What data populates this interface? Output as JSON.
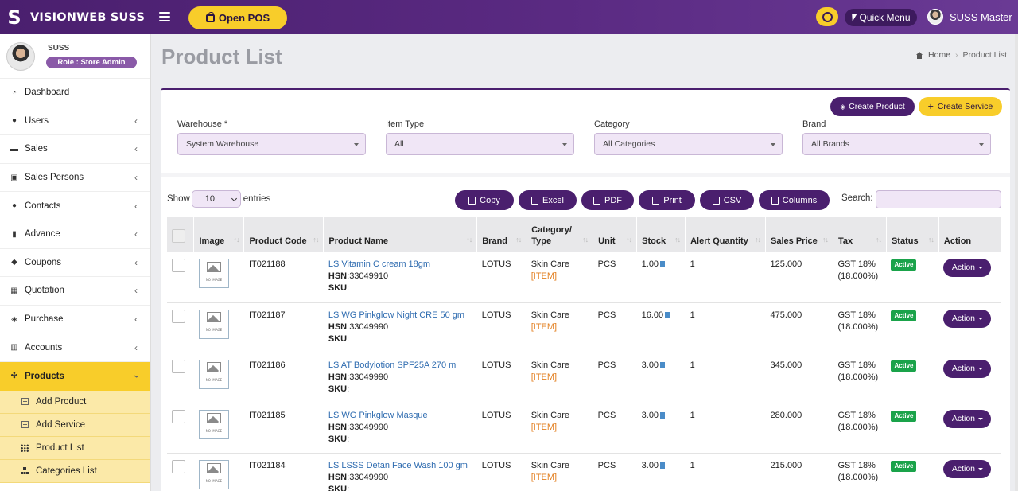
{
  "app": {
    "name": "VISIONWEB SUSS",
    "logo_letter": "S"
  },
  "topbar": {
    "open_pos": "Open POS",
    "quick_menu": "Quick Menu",
    "user": "SUSS Master"
  },
  "profile": {
    "name": "SUSS",
    "role": "Role : Store Admin"
  },
  "nav": [
    {
      "label": "Dashboard",
      "icon": "dashboard-icon",
      "glyph": "◔",
      "chevron": false
    },
    {
      "label": "Users",
      "icon": "user-icon",
      "glyph": "●",
      "chevron": true
    },
    {
      "label": "Sales",
      "icon": "cart-icon",
      "glyph": "▬",
      "chevron": true
    },
    {
      "label": "Sales Persons",
      "icon": "id-card-icon",
      "glyph": "▣",
      "chevron": true
    },
    {
      "label": "Contacts",
      "icon": "users-icon",
      "glyph": "●",
      "chevron": true
    },
    {
      "label": "Advance",
      "icon": "book-icon",
      "glyph": "▮",
      "chevron": true
    },
    {
      "label": "Coupons",
      "icon": "tag-icon",
      "glyph": "◆",
      "chevron": true
    },
    {
      "label": "Quotation",
      "icon": "calendar-icon",
      "glyph": "▦",
      "chevron": true
    },
    {
      "label": "Purchase",
      "icon": "cube-icon",
      "glyph": "◈",
      "chevron": true
    },
    {
      "label": "Accounts",
      "icon": "bank-icon",
      "glyph": "▥",
      "chevron": true
    },
    {
      "label": "Products",
      "icon": "cubes-icon",
      "glyph": "✣",
      "chevron": true,
      "active": true
    }
  ],
  "subnav": [
    {
      "label": "Add Product",
      "icon": "plus-square-icon"
    },
    {
      "label": "Add Service",
      "icon": "plus-square-icon"
    },
    {
      "label": "Product List",
      "icon": "grid-icon"
    },
    {
      "label": "Categories List",
      "icon": "sitemap-icon"
    }
  ],
  "page": {
    "title": "Product List",
    "breadcrumb": [
      "Home",
      "Product List"
    ]
  },
  "actions": {
    "create_product": "Create Product",
    "create_service": "Create Service"
  },
  "filters": [
    {
      "label": "Warehouse *",
      "value": "System Warehouse"
    },
    {
      "label": "Item Type",
      "value": "All"
    },
    {
      "label": "Category",
      "value": "All Categories"
    },
    {
      "label": "Brand",
      "value": "All Brands"
    }
  ],
  "table_tools": {
    "show": "Show",
    "entries_value": "10",
    "entries": "entries",
    "buttons": [
      "Copy",
      "Excel",
      "PDF",
      "Print",
      "CSV",
      "Columns"
    ],
    "search_label": "Search:"
  },
  "columns": [
    "",
    "Image",
    "Product Code",
    "Product Name",
    "Brand",
    "Category/ Type",
    "Unit",
    "Stock",
    "Alert Quantity",
    "Sales Price",
    "Tax",
    "Status",
    "Action"
  ],
  "rows": [
    {
      "code": "IT021188",
      "name": "LS Vitamin C cream 18gm",
      "hsn": "33049910",
      "brand": "LOTUS",
      "category": "Skin Care",
      "type": "ITEM",
      "unit": "PCS",
      "stock": "1.00",
      "alert": "1",
      "price": "125.000",
      "tax": "GST 18%",
      "tax_pct": "(18.000%)",
      "status": "Active",
      "action": "Action"
    },
    {
      "code": "IT021187",
      "name": "LS WG Pinkglow Night CRE 50 gm",
      "hsn": "33049990",
      "brand": "LOTUS",
      "category": "Skin Care",
      "type": "ITEM",
      "unit": "PCS",
      "stock": "16.00",
      "alert": "1",
      "price": "475.000",
      "tax": "GST 18%",
      "tax_pct": "(18.000%)",
      "status": "Active",
      "action": "Action"
    },
    {
      "code": "IT021186",
      "name": "LS AT Bodylotion SPF25A 270 ml",
      "hsn": "33049990",
      "brand": "LOTUS",
      "category": "Skin Care",
      "type": "ITEM",
      "unit": "PCS",
      "stock": "3.00",
      "alert": "1",
      "price": "345.000",
      "tax": "GST 18%",
      "tax_pct": "(18.000%)",
      "status": "Active",
      "action": "Action"
    },
    {
      "code": "IT021185",
      "name": "LS WG Pinkglow Masque",
      "hsn": "33049990",
      "brand": "LOTUS",
      "category": "Skin Care",
      "type": "ITEM",
      "unit": "PCS",
      "stock": "3.00",
      "alert": "1",
      "price": "280.000",
      "tax": "GST 18%",
      "tax_pct": "(18.000%)",
      "status": "Active",
      "action": "Action"
    },
    {
      "code": "IT021184",
      "name": "LS LSSS Detan Face Wash 100 gm",
      "hsn": "33049990",
      "brand": "LOTUS",
      "category": "Skin Care",
      "type": "ITEM",
      "unit": "PCS",
      "stock": "3.00",
      "alert": "1",
      "price": "215.000",
      "tax": "GST 18%",
      "tax_pct": "(18.000%)",
      "status": "Active",
      "action": "Action"
    }
  ],
  "labels": {
    "hsn": "HSN",
    "sku": "SKU",
    "no_image": "NO IMAGE"
  },
  "colors": {
    "primary": "#4a1f6e",
    "accent": "#f8cd2a",
    "active": "#1aa34a",
    "link": "#2f6cb0"
  }
}
